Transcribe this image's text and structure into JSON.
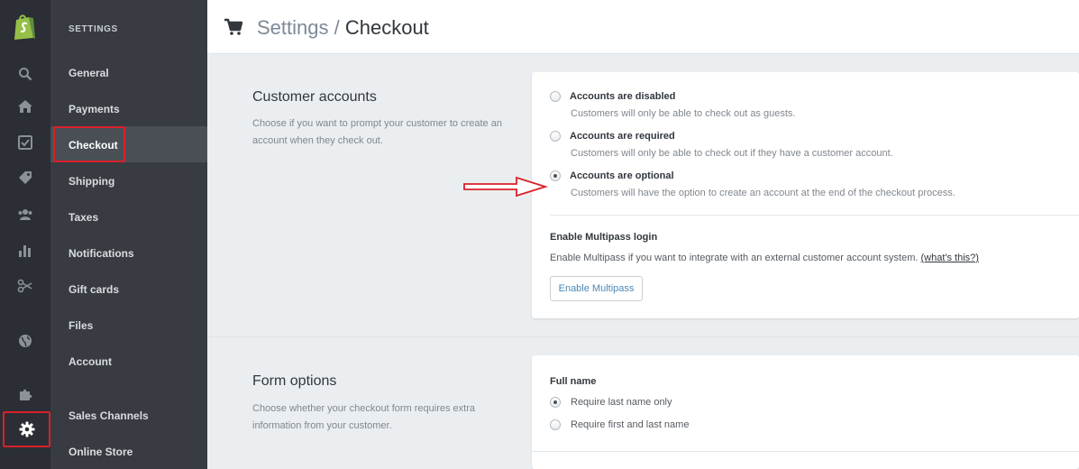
{
  "sidebar": {
    "heading": "SETTINGS",
    "items": [
      {
        "label": "General"
      },
      {
        "label": "Payments"
      },
      {
        "label": "Checkout"
      },
      {
        "label": "Shipping"
      },
      {
        "label": "Taxes"
      },
      {
        "label": "Notifications"
      },
      {
        "label": "Gift cards"
      },
      {
        "label": "Files"
      },
      {
        "label": "Account"
      },
      {
        "label": "Sales Channels"
      },
      {
        "label": "Online Store"
      }
    ]
  },
  "header": {
    "crumb_parent": "Settings",
    "separator": " / ",
    "crumb_current": "Checkout"
  },
  "customer_accounts": {
    "title": "Customer accounts",
    "description": "Choose if you want to prompt your customer to create an account when they check out.",
    "options": [
      {
        "label": "Accounts are disabled",
        "sub": "Customers will only be able to check out as guests.",
        "selected": false
      },
      {
        "label": "Accounts are required",
        "sub": "Customers will only be able to check out if they have a customer account.",
        "selected": false
      },
      {
        "label": "Accounts are optional",
        "sub": "Customers will have the option to create an account at the end of the checkout process.",
        "selected": true
      }
    ],
    "multipass_title": "Enable Multipass login",
    "multipass_text": "Enable Multipass if you want to integrate with an external customer account system.",
    "multipass_link": "(what's this?)",
    "multipass_button": "Enable Multipass"
  },
  "form_options": {
    "title": "Form options",
    "description": "Choose whether your checkout form requires extra information from your customer.",
    "full_name_title": "Full name",
    "options": [
      {
        "label": "Require last name only",
        "selected": true
      },
      {
        "label": "Require first and last name",
        "selected": false
      }
    ]
  },
  "colors": {
    "highlight": "#d9202b",
    "brand_green": "#96bf48"
  }
}
